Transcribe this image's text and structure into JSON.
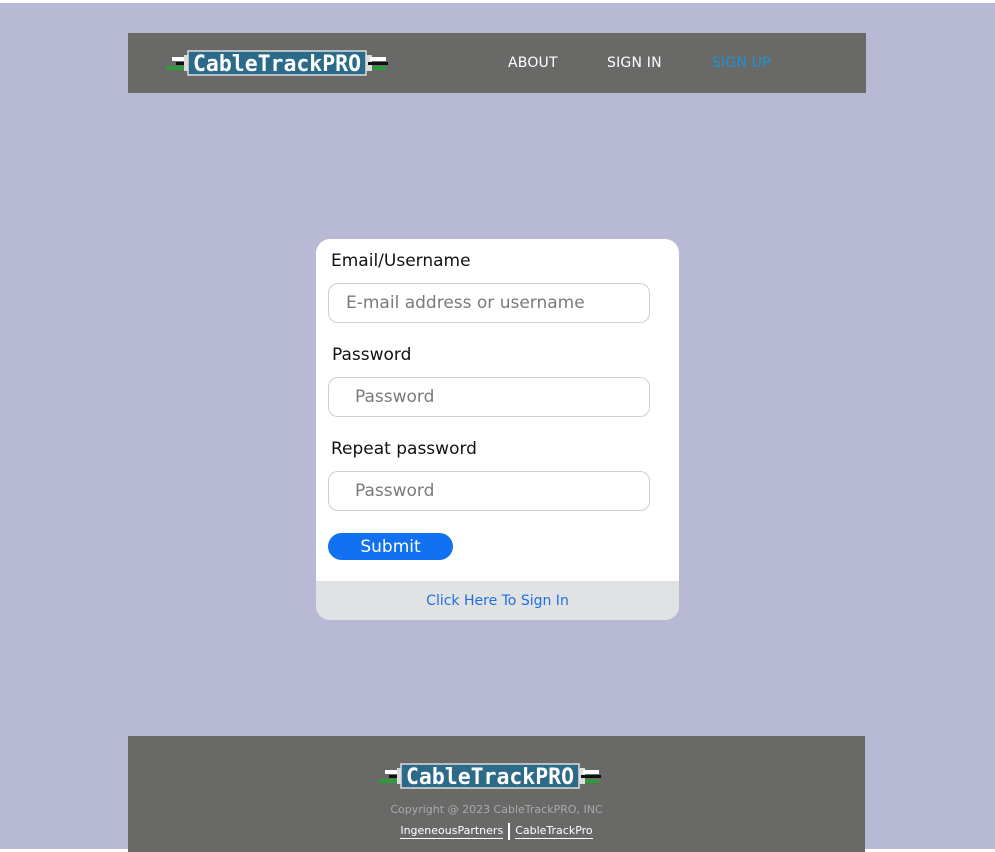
{
  "brand": {
    "logo_text": "CableTrackPRO",
    "logo_icon": "cable-plug-logo"
  },
  "nav": {
    "about": "ABOUT",
    "sign_in": "SIGN IN",
    "sign_up": "SIGN UP",
    "active_item": "sign_up"
  },
  "form": {
    "email_label": "Email/Username",
    "email_placeholder": "E-mail address or username",
    "password_label": "Password",
    "password_placeholder": "Password",
    "repeat_label": "Repeat password",
    "repeat_placeholder": "Password",
    "submit_label": "Submit",
    "sign_in_link": "Click Here To Sign In"
  },
  "footer": {
    "copyright": "Copyright @ 2023 CableTrackPRO, INC",
    "links": [
      "IngeneousPartners",
      "CableTrackPro"
    ]
  },
  "colors": {
    "page_bg": "#b8b9d5",
    "bar_bg": "#696a68",
    "accent": "#1271f0",
    "active_nav": "#1d92d6",
    "logo_plate": "#2c6a8a"
  }
}
